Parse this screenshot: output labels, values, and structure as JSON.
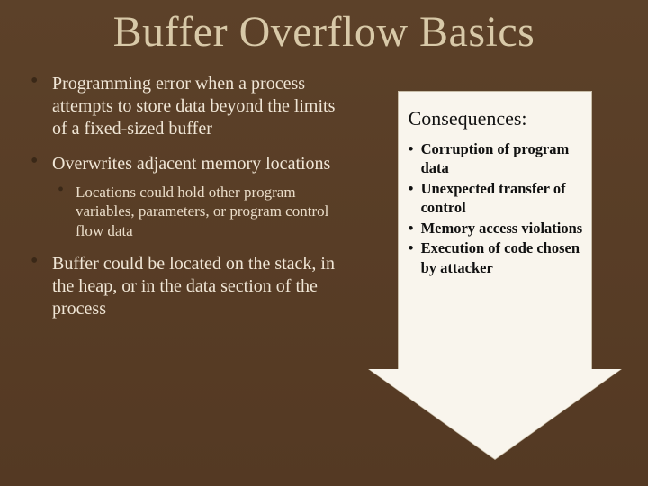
{
  "title": "Buffer Overflow Basics",
  "bullets": {
    "b1": "Programming error when a process attempts to store data beyond the limits of a fixed-sized buffer",
    "b2": "Overwrites adjacent memory locations",
    "b2_sub": "Locations could hold other program variables, parameters, or program control flow data",
    "b3": "Buffer could be located on the stack, in the heap, or in the data section of the process"
  },
  "consequences": {
    "heading": "Consequences:",
    "items": {
      "c1": "Corruption of program data",
      "c2": "Unexpected transfer of control",
      "c3": "Memory access violations",
      "c4": "Execution of code chosen by attacker"
    }
  }
}
